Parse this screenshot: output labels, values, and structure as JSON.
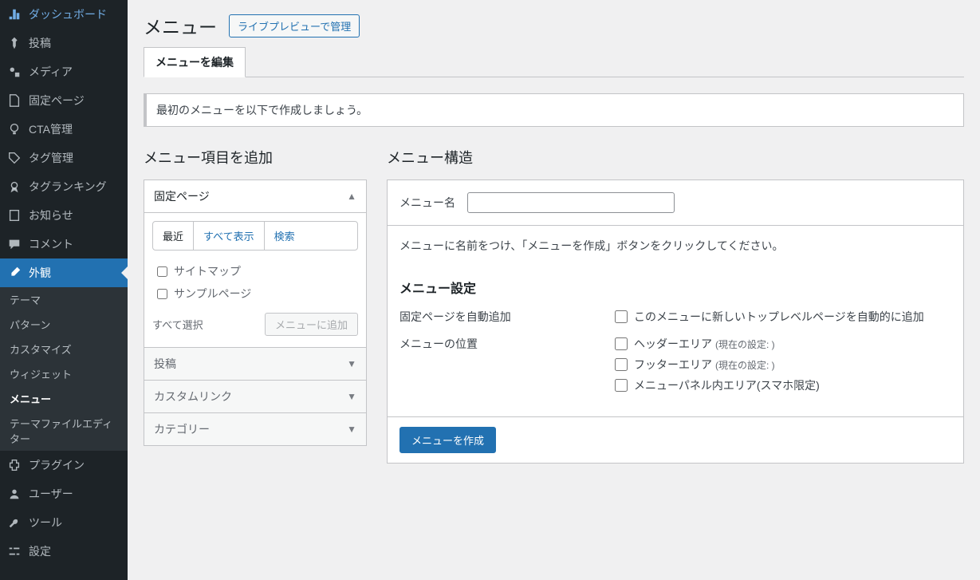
{
  "sidebar": {
    "items": [
      {
        "icon": "dashboard",
        "label": "ダッシュボード"
      },
      {
        "icon": "pin",
        "label": "投稿"
      },
      {
        "icon": "media",
        "label": "メディア"
      },
      {
        "icon": "page",
        "label": "固定ページ"
      },
      {
        "icon": "bulb",
        "label": "CTA管理"
      },
      {
        "icon": "tag",
        "label": "タグ管理"
      },
      {
        "icon": "award",
        "label": "タグランキング"
      },
      {
        "icon": "book",
        "label": "お知らせ"
      },
      {
        "icon": "comment",
        "label": "コメント"
      },
      {
        "icon": "brush",
        "label": "外観"
      },
      {
        "icon": "plugin",
        "label": "プラグイン"
      },
      {
        "icon": "user",
        "label": "ユーザー"
      },
      {
        "icon": "tool",
        "label": "ツール"
      },
      {
        "icon": "settings",
        "label": "設定"
      }
    ],
    "submenu": [
      "テーマ",
      "パターン",
      "カスタマイズ",
      "ウィジェット",
      "メニュー",
      "テーマファイルエディター"
    ]
  },
  "header": {
    "title": "メニュー",
    "live_preview_button": "ライブプレビューで管理"
  },
  "tab": {
    "edit": "メニューを編集"
  },
  "notice": "最初のメニューを以下で作成しましょう。",
  "left": {
    "title": "メニュー項目を追加",
    "panels": {
      "pages": "固定ページ",
      "posts": "投稿",
      "custom": "カスタムリンク",
      "cats": "カテゴリー"
    },
    "subtabs": {
      "recent": "最近",
      "all": "すべて表示",
      "search": "検索"
    },
    "checks": {
      "sitemap": "サイトマップ",
      "sample": "サンプルページ"
    },
    "select_all": "すべて選択",
    "add_btn": "メニューに追加"
  },
  "right": {
    "title": "メニュー構造",
    "name_label": "メニュー名",
    "instruction": "メニューに名前をつけ、「メニューを作成」ボタンをクリックしてください。",
    "settings_title": "メニュー設定",
    "auto_add": {
      "label": "固定ページを自動追加",
      "opt": "このメニューに新しいトップレベルページを自動的に追加"
    },
    "location": {
      "label": "メニューの位置",
      "opts": {
        "header": "ヘッダーエリア",
        "header_hint": "(現在の設定: )",
        "footer": "フッターエリア",
        "footer_hint": "(現在の設定: )",
        "mobile": "メニューパネル内エリア(スマホ限定)"
      }
    },
    "create_btn": "メニューを作成"
  }
}
